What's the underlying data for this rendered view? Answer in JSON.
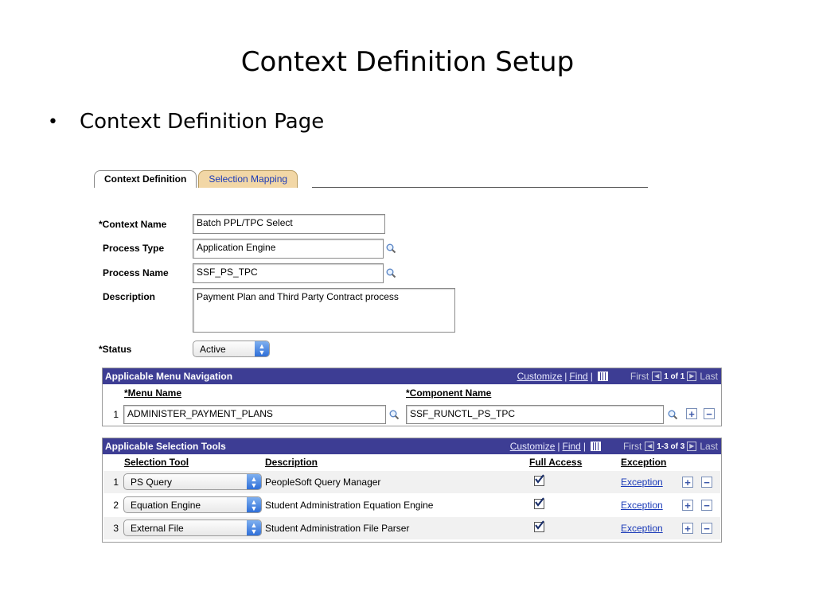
{
  "slide": {
    "title": "Context Definition Setup",
    "bullet": "Context Definition Page"
  },
  "tabs": [
    {
      "label": "Context Definition",
      "active": true
    },
    {
      "label": "Selection Mapping",
      "active": false
    }
  ],
  "form": {
    "context_name": {
      "label": "*Context Name",
      "value": "Batch PPL/TPC Select"
    },
    "process_type": {
      "label": "Process Type",
      "value": "Application Engine"
    },
    "process_name": {
      "label": "Process Name",
      "value": "SSF_PS_TPC"
    },
    "description": {
      "label": "Description",
      "value": "Payment Plan and Third Party Contract process"
    },
    "status": {
      "label": "*Status",
      "value": "Active"
    }
  },
  "menu_nav": {
    "title": "Applicable Menu Navigation",
    "customize": "Customize",
    "find": "Find",
    "first": "First",
    "range": "1 of 1",
    "last": "Last",
    "col_menu": "*Menu Name",
    "col_component": "*Component Name",
    "rows": [
      {
        "num": "1",
        "menu": "ADMINISTER_PAYMENT_PLANS",
        "component": "SSF_RUNCTL_PS_TPC"
      }
    ]
  },
  "sel_tools": {
    "title": "Applicable Selection Tools",
    "customize": "Customize",
    "find": "Find",
    "first": "First",
    "range": "1-3 of 3",
    "last": "Last",
    "col_tool": "Selection Tool",
    "col_desc": "Description",
    "col_access": "Full Access",
    "col_exception": "Exception",
    "rows": [
      {
        "num": "1",
        "tool": "PS Query",
        "desc": "PeopleSoft Query Manager",
        "full_access": true,
        "exception": "Exception"
      },
      {
        "num": "2",
        "tool": "Equation Engine",
        "desc": "Student Administration Equation Engine",
        "full_access": true,
        "exception": "Exception"
      },
      {
        "num": "3",
        "tool": "External File",
        "desc": "Student Administration File Parser",
        "full_access": true,
        "exception": "Exception"
      }
    ]
  },
  "colors": {
    "grid_header": "#3d3d94",
    "link": "#1a3ab8",
    "tab_inactive": "#f2d7a6"
  }
}
